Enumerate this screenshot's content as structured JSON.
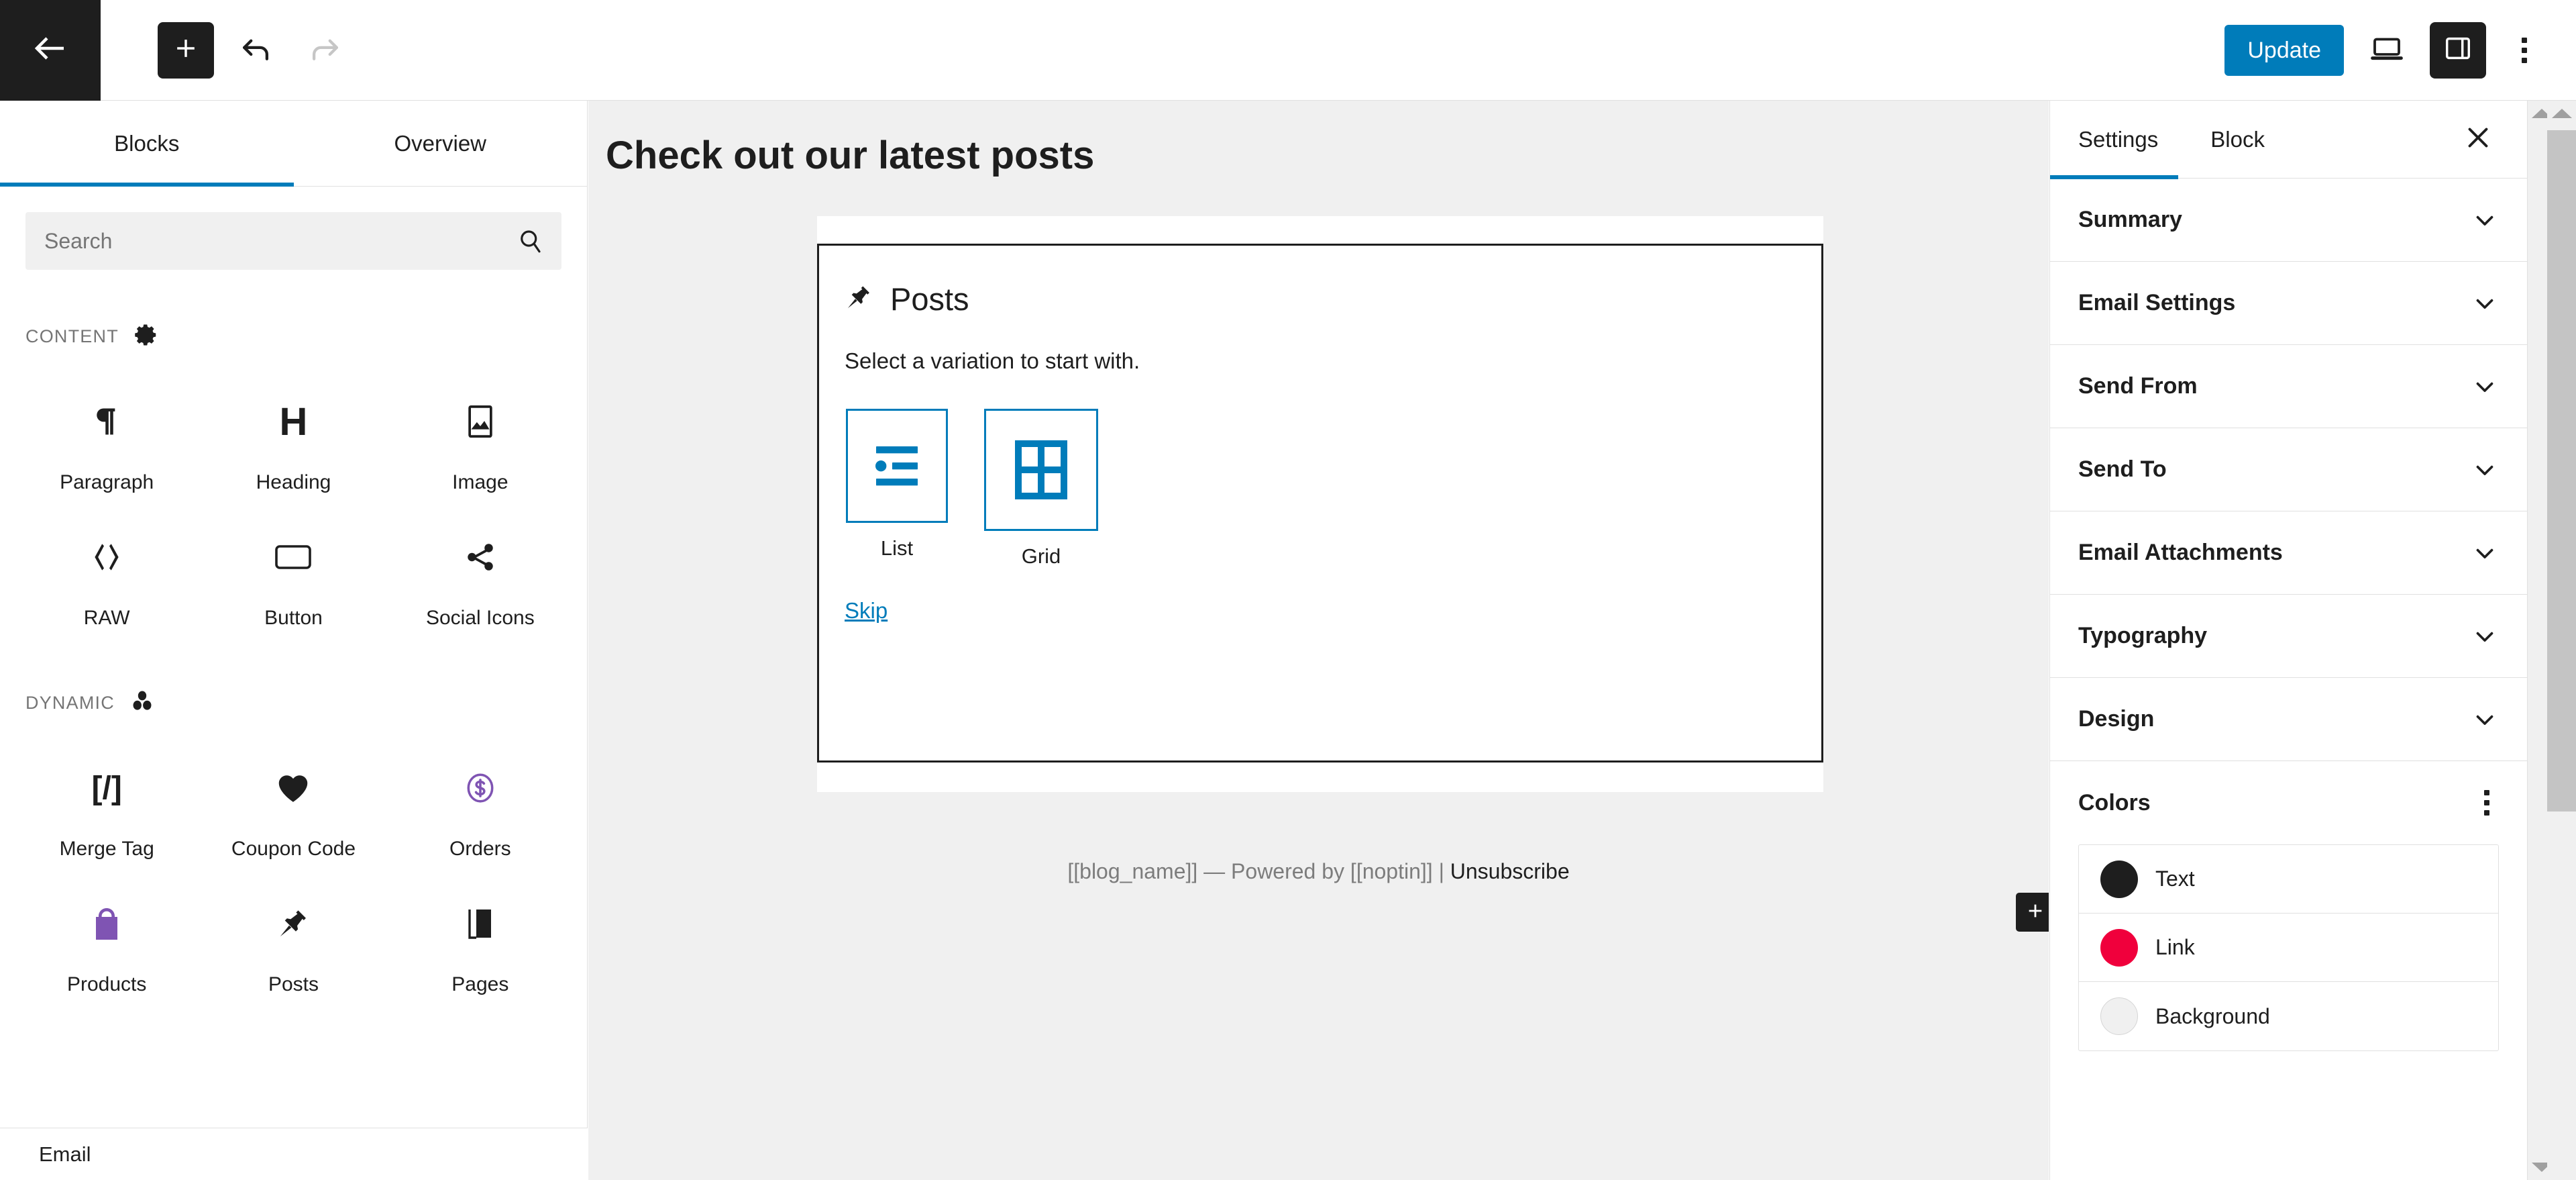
{
  "header": {
    "back_icon": "arrow-left-icon",
    "add_block_icon": "plus-icon",
    "undo_icon": "undo-icon",
    "redo_icon": "redo-icon",
    "update_label": "Update",
    "preview_icon": "desktop-preview-icon",
    "sidebar_toggle_icon": "settings-panel-icon",
    "options_icon": "kebab-menu-icon",
    "accent_color": "#007cba",
    "dark_color": "#1e1e1e"
  },
  "inserter": {
    "tabs": [
      {
        "label": "Blocks",
        "active": true
      },
      {
        "label": "Overview",
        "active": false
      }
    ],
    "search": {
      "value": "",
      "placeholder": "Search",
      "icon": "search-icon"
    },
    "categories": [
      {
        "label": "CONTENT",
        "icon": "gear-icon",
        "blocks": [
          {
            "label": "Paragraph",
            "icon": "pilcrow-icon",
            "glyph": "¶",
            "color": "#1e1e1e"
          },
          {
            "label": "Heading",
            "icon": "heading-icon",
            "glyph": "H",
            "color": "#1e1e1e"
          },
          {
            "label": "Image",
            "icon": "image-icon",
            "glyph": "",
            "color": "#1e1e1e"
          },
          {
            "label": "RAW",
            "icon": "code-icon",
            "glyph": "‹›",
            "color": "#1e1e1e"
          },
          {
            "label": "Button",
            "icon": "button-icon",
            "glyph": "",
            "color": "#1e1e1e"
          },
          {
            "label": "Social Icons",
            "icon": "share-icon",
            "glyph": "",
            "color": "#1e1e1e"
          }
        ]
      },
      {
        "label": "DYNAMIC",
        "icon": "blocks-group-icon",
        "blocks": [
          {
            "label": "Merge Tag",
            "icon": "merge-tag-icon",
            "glyph": "[/]",
            "color": "#1e1e1e"
          },
          {
            "label": "Coupon Code",
            "icon": "heart-icon",
            "glyph": "♥",
            "color": "#1e1e1e"
          },
          {
            "label": "Orders",
            "icon": "dollar-circle-icon",
            "glyph": "",
            "color": "#7f54b3"
          },
          {
            "label": "Products",
            "icon": "shopping-bag-icon",
            "glyph": "",
            "color": "#7f54b3"
          },
          {
            "label": "Posts",
            "icon": "pin-icon",
            "glyph": "",
            "color": "#1e1e1e"
          },
          {
            "label": "Pages",
            "icon": "pages-icon",
            "glyph": "",
            "color": "#1e1e1e"
          }
        ]
      }
    ]
  },
  "status_bar": {
    "label": "Email"
  },
  "canvas": {
    "title": "Check out our latest posts",
    "block": {
      "icon": "pin-icon",
      "title": "Posts",
      "subtitle": "Select a variation to start with.",
      "variations": [
        {
          "label": "List",
          "icon": "list-variation-icon"
        },
        {
          "label": "Grid",
          "icon": "grid-variation-icon"
        }
      ],
      "skip_label": "Skip"
    },
    "footer": {
      "prefix": "[[blog_name]] — Powered by [[noptin]] | ",
      "unsubscribe": "Unsubscribe"
    },
    "add_button_icon": "plus-icon"
  },
  "settings": {
    "tabs": [
      {
        "label": "Settings",
        "active": true
      },
      {
        "label": "Block",
        "active": false
      }
    ],
    "close_icon": "close-icon",
    "sections": [
      {
        "label": "Summary",
        "icon": "chevron-down-icon"
      },
      {
        "label": "Email Settings",
        "icon": "chevron-down-icon"
      },
      {
        "label": "Send From",
        "icon": "chevron-down-icon"
      },
      {
        "label": "Send To",
        "icon": "chevron-down-icon"
      },
      {
        "label": "Email Attachments",
        "icon": "chevron-down-icon"
      },
      {
        "label": "Typography",
        "icon": "chevron-down-icon"
      },
      {
        "label": "Design",
        "icon": "chevron-down-icon"
      }
    ],
    "colors": {
      "label": "Colors",
      "menu_icon": "kebab-menu-icon",
      "items": [
        {
          "label": "Text",
          "value": "#1e1e1e"
        },
        {
          "label": "Link",
          "value": "#f0003c"
        },
        {
          "label": "Background",
          "value": "#f0f0f0"
        }
      ]
    }
  },
  "scrollbars": {
    "inner": {
      "up_icon": "arrow-up-icon",
      "down_icon": "arrow-down-icon"
    },
    "outer": {
      "up_icon": "arrow-up-icon",
      "down_icon": "arrow-down-icon"
    }
  }
}
